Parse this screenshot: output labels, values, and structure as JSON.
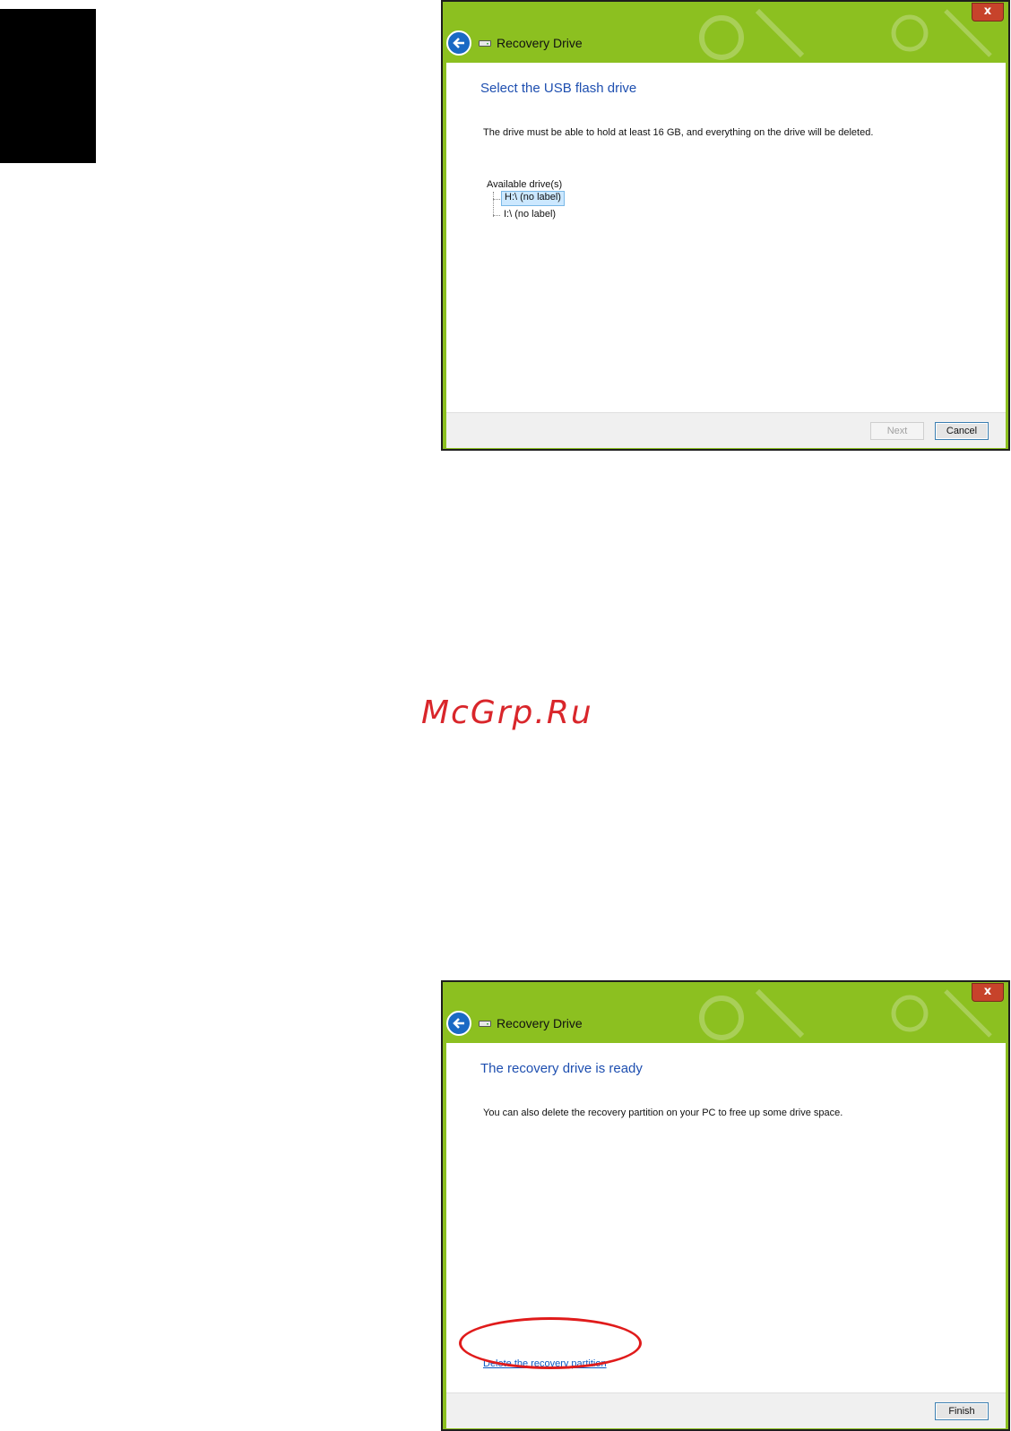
{
  "watermark": "McGrp.Ru",
  "colors": {
    "window_frame": "#8cc020",
    "heading": "#1e4fb0",
    "close_button": "#c7432b",
    "back_button": "#1a69c4",
    "annotation": "#e01b1b"
  },
  "window1": {
    "title": "Recovery Drive",
    "close_glyph": "x",
    "heading": "Select the USB flash drive",
    "description": "The drive must be able to hold at least 16 GB, and everything on the drive will be deleted.",
    "tree_label": "Available drive(s)",
    "drives": [
      {
        "label": "H:\\ (no label)",
        "selected": true
      },
      {
        "label": "I:\\ (no label)",
        "selected": false
      }
    ],
    "next_button": "Next",
    "cancel_button": "Cancel"
  },
  "window2": {
    "title": "Recovery Drive",
    "close_glyph": "x",
    "heading": "The recovery drive is ready",
    "description": "You can also delete the recovery partition on your PC to free up some drive space.",
    "delete_link": "Delete the recovery partition",
    "finish_button": "Finish"
  }
}
